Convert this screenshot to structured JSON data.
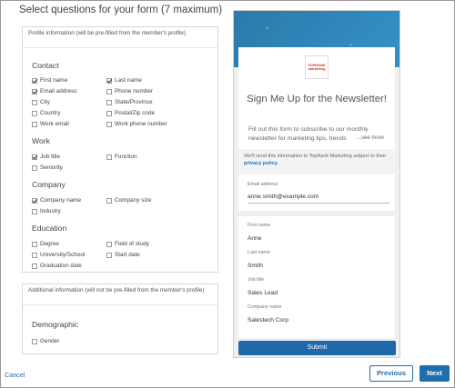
{
  "page": {
    "title": "Select questions for your form (7 maximum)"
  },
  "profile_panel": {
    "header": "Profile information (will be pre-filled from the member's profile)",
    "groups": [
      {
        "title": "Contact",
        "options": [
          {
            "label": "First name",
            "checked": true
          },
          {
            "label": "Last name",
            "checked": true
          },
          {
            "label": "Email address",
            "checked": true
          },
          {
            "label": "Phone number",
            "checked": false
          },
          {
            "label": "City",
            "checked": false
          },
          {
            "label": "State/Province",
            "checked": false
          },
          {
            "label": "Country",
            "checked": false
          },
          {
            "label": "Postal/Zip code",
            "checked": false
          },
          {
            "label": "Work email",
            "checked": false
          },
          {
            "label": "Work phone number",
            "checked": false
          }
        ]
      },
      {
        "title": "Work",
        "options": [
          {
            "label": "Job title",
            "checked": true
          },
          {
            "label": "Function",
            "checked": false
          },
          {
            "label": "Seniority",
            "checked": false
          }
        ]
      },
      {
        "title": "Company",
        "options": [
          {
            "label": "Company name",
            "checked": true
          },
          {
            "label": "Company size",
            "checked": false
          },
          {
            "label": "Industry",
            "checked": false
          }
        ]
      },
      {
        "title": "Education",
        "options": [
          {
            "label": "Degree",
            "checked": false
          },
          {
            "label": "Field of study",
            "checked": false
          },
          {
            "label": "University/School",
            "checked": false
          },
          {
            "label": "Start date",
            "checked": false
          },
          {
            "label": "Graduation date",
            "checked": false
          }
        ]
      }
    ]
  },
  "additional_panel": {
    "header": "Additional information (will not be pre-filled from the member's profile)",
    "group_title": "Demographic",
    "options": [
      {
        "label": "Gender",
        "checked": false
      }
    ]
  },
  "preview": {
    "logo_text": "TOPRANK marketing",
    "title": "Sign Me Up for the Newsletter!",
    "description": "Fill out this form to subscribe to our monthly newsletter for marketing tips, trends",
    "see_more": "...see more",
    "notice_text": "We'll send this information to TopRank Marketing subject to their",
    "notice_link": "privacy policy.",
    "fields": [
      {
        "label": "Email address",
        "value": "anne.smith@example.com"
      },
      {
        "label": "First name",
        "value": "Anne"
      },
      {
        "label": "Last name",
        "value": "Smith"
      },
      {
        "label": "Job title",
        "value": "Sales Lead"
      },
      {
        "label": "Company name",
        "value": "Salestech Corp"
      }
    ],
    "submit_label": "Submit"
  },
  "footer": {
    "cancel_label": "Cancel",
    "previous_label": "Previous",
    "next_label": "Next"
  },
  "colors": {
    "accent": "#1e6fb0",
    "banner": "#2b7fb0",
    "submit": "#2068a8"
  }
}
